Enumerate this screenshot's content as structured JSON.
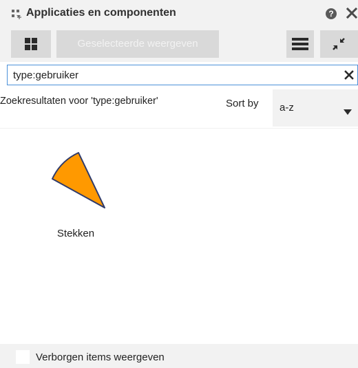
{
  "panel": {
    "title": "Applicaties en componenten",
    "help_symbol": "?"
  },
  "toolbar": {
    "grid_view_icon": "grid-icon",
    "selected_view_label": "Geselecteerde weergeven",
    "list_view_icon": "list-icon",
    "collapse_icon": "collapse-arrows-icon"
  },
  "search": {
    "value": "type:gebruiker",
    "clear_icon": "close-icon"
  },
  "results": {
    "heading": "Zoekresultaten voor 'type:gebruiker'",
    "sort_label": "Sort by",
    "sort_value": "a-z",
    "items": [
      {
        "label": "Stekken",
        "icon": "pie-wedge-icon",
        "icon_fill": "#ff9900",
        "icon_stroke": "#2f3b6b"
      }
    ]
  },
  "footer": {
    "show_hidden_label": "Verborgen items weergeven",
    "show_hidden_checked": false
  },
  "colors": {
    "chrome_background": "#f2f2f2",
    "button_background": "#d9d9d9",
    "search_border": "#4a90d9"
  }
}
